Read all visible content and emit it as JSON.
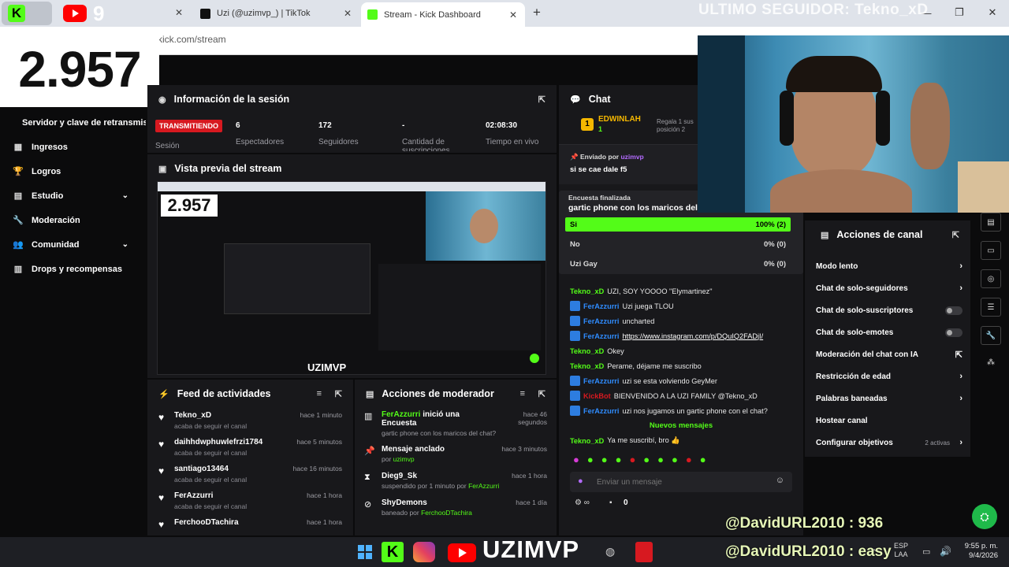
{
  "browser": {
    "tabs": [
      {
        "label": "Uzi (@uzimvp_) | TikTok",
        "color": "#111111"
      },
      {
        "label": "Stream - Kick Dashboard",
        "color": "#53fc18"
      }
    ],
    "url": "kick.com/stream",
    "new_tab_symbol": "+"
  },
  "overlay": {
    "last_follower": "ULTIMO SEGUIDOR: Tekno_xD",
    "follower_count": "2.957",
    "donor_line_1": "@DavidURL2010 : 936",
    "donor_line_2": "@DavidURL2010 : easy",
    "channel_name": "UZIMVP",
    "channel_name_small": "UZIMVP"
  },
  "sidebar": {
    "items": [
      {
        "label": "Servidor y clave de retransmisión",
        "icon": "key-icon"
      },
      {
        "label": "Ingresos",
        "icon": "chart-icon"
      },
      {
        "label": "Logros",
        "icon": "trophy-icon"
      },
      {
        "label": "Estudio",
        "icon": "grid-icon"
      },
      {
        "label": "Moderación",
        "icon": "wrench-icon"
      },
      {
        "label": "Comunidad",
        "icon": "users-icon"
      },
      {
        "label": "Drops y recompensas",
        "icon": "gift-icon"
      }
    ]
  },
  "session": {
    "title": "Información de la sesión",
    "live_badge": "TRANSMITIENDO",
    "stats": [
      {
        "value": "",
        "label": "Sesión"
      },
      {
        "value": "6",
        "label": "Espectadores"
      },
      {
        "value": "172",
        "label": "Seguidores"
      },
      {
        "value": "-",
        "label": "Cantidad de suscripciones"
      },
      {
        "value": "02:08:30",
        "label": "Tiempo en vivo"
      }
    ]
  },
  "preview": {
    "title": "Vista previa del stream"
  },
  "feed": {
    "title": "Feed de actividades",
    "items": [
      {
        "name": "Tekno_xD",
        "sub": "acaba de seguir el canal",
        "time": "hace 1 minuto"
      },
      {
        "name": "daihhdwphuwlefrzi1784",
        "sub": "acaba de seguir el canal",
        "time": "hace 5 minutos"
      },
      {
        "name": "santiago13464",
        "sub": "acaba de seguir el canal",
        "time": "hace 16 minutos"
      },
      {
        "name": "FerAzzurri",
        "sub": "acaba de seguir el canal",
        "time": "hace 1 hora"
      },
      {
        "name": "FerchooDTachira",
        "sub": "",
        "time": "hace 1 hora"
      }
    ]
  },
  "modactions": {
    "title": "Acciones de moderador",
    "items": [
      {
        "actor": "FerAzzurri",
        "action": " inició una Encuesta",
        "sub": "gartic phone con los maricos del chat?",
        "time": "hace 46 segundos"
      },
      {
        "actor": "",
        "action": "Mensaje anclado",
        "sub_prefix": "por ",
        "sub_user": "uzimvp",
        "time": "hace 3 minutos"
      },
      {
        "actor": "",
        "action": "Dieg9_Sk",
        "sub_prefix": "suspendido por 1 minuto por ",
        "sub_user": "FerAzzurri",
        "time": "hace 1 hora"
      },
      {
        "actor": "",
        "action": "ShyDemons",
        "sub_prefix": "baneado por ",
        "sub_user": "FerchooDTachira",
        "time": "hace 1 día"
      }
    ]
  },
  "chat": {
    "title": "Chat",
    "top_gifter": {
      "name": "EDWINLAH",
      "count": "1",
      "rank": "1",
      "promo": "Regala 1 sus posición 2"
    },
    "pinned": {
      "label": "Enviado por",
      "user": "uzimvp",
      "message": "si se cae dale f5"
    },
    "poll": {
      "status": "Encuesta finalizada",
      "question": "gartic phone con los maricos del chat?",
      "options": [
        {
          "label": "Si",
          "pct": "100% (2)",
          "share": 1.0
        },
        {
          "label": "No",
          "pct": "0% (0)",
          "share": 0
        },
        {
          "label": "Uzi Gay",
          "pct": "0% (0)",
          "share": 0
        }
      ]
    },
    "messages": [
      {
        "user": "Tekno_xD",
        "text": "UZI, SOY YOOOO \"Elymartinez\"",
        "color": "#53fc18",
        "badge": false
      },
      {
        "user": "FerAzzurri",
        "text": "Uzi juega TLOU",
        "color": "#2f8cff",
        "badge": true
      },
      {
        "user": "FerAzzurri",
        "text": "uncharted",
        "color": "#2f8cff",
        "badge": true
      },
      {
        "user": "FerAzzurri",
        "text": "https://www.instagram.com/p/DQuIQ2FADjI/",
        "color": "#2f8cff",
        "badge": true,
        "link": true
      },
      {
        "user": "Tekno_xD",
        "text": "Okey",
        "color": "#53fc18",
        "badge": false
      },
      {
        "user": "Tekno_xD",
        "text": "Perame, déjame me suscribo",
        "color": "#53fc18",
        "badge": false
      },
      {
        "user": "FerAzzurri",
        "text": "uzi se esta volviendo GeyMer",
        "color": "#2f8cff",
        "badge": true
      },
      {
        "user": "KickBot",
        "text": "BIENVENIDO A LA UZI FAMILY @Tekno_xD",
        "color": "#d71920",
        "badge": true
      },
      {
        "user": "FerAzzurri",
        "text": "uzi nos jugamos un gartic phone con el chat?",
        "color": "#2f8cff",
        "badge": true
      }
    ],
    "new_messages": "Nuevos mensajes",
    "last": {
      "user": "Tekno_xD",
      "text": "Ya me suscribí, bro 👍"
    },
    "input_placeholder": "Enviar un mensaje",
    "viewer_count": "0"
  },
  "channel_actions": {
    "title": "Acciones de canal",
    "items": [
      {
        "label": "Modo lento",
        "type": "chevron"
      },
      {
        "label": "Chat de solo-seguidores",
        "type": "chevron"
      },
      {
        "label": "Chat de solo-suscriptores",
        "type": "toggle"
      },
      {
        "label": "Chat de solo-emotes",
        "type": "toggle"
      },
      {
        "label": "Moderación del chat con IA",
        "type": "link"
      },
      {
        "label": "Restricción de edad",
        "type": "chevron"
      },
      {
        "label": "Palabras baneadas",
        "type": "chevron"
      },
      {
        "label": "Hostear canal",
        "type": "none"
      },
      {
        "label": "Configurar objetivos",
        "type": "chevron",
        "extra": "2 activas"
      }
    ]
  },
  "taskbar": {
    "lang": "ESP",
    "lang2": "LAA",
    "time": "9:55 p. m.",
    "date": "9/4/2026"
  },
  "colors": {
    "accent": "#53fc18",
    "panel": "#18181b",
    "live": "#d71920"
  }
}
